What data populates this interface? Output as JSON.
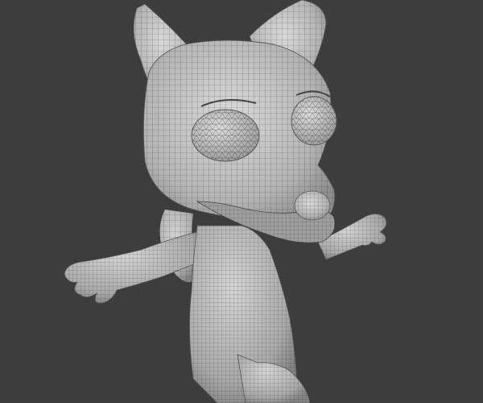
{
  "viewport": {
    "background_color": "#3d3d3d",
    "subject": "wolf-cartoon-mesh",
    "render_style": "wireframe-on-shaded",
    "mesh_base_color": "#c8c8c8",
    "wire_color": "#2a2a2a"
  }
}
